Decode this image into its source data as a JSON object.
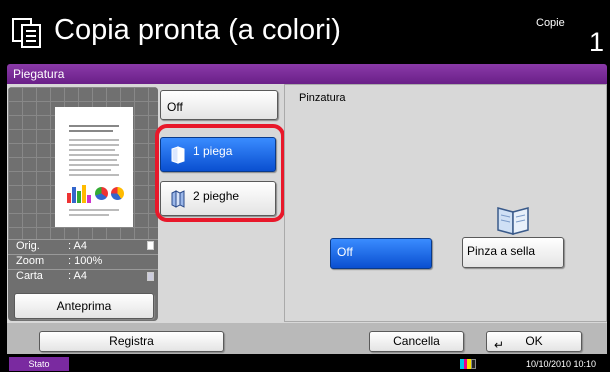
{
  "header": {
    "title": "Copia pronta (a colori)",
    "copies_label": "Copie",
    "copies_value": "1",
    "app_icon": "copy-icon"
  },
  "tab": {
    "label": "Piegatura"
  },
  "preview": {
    "info": [
      {
        "key": "Orig.",
        "value": ": A4"
      },
      {
        "key": "Zoom",
        "value": ": 100%"
      },
      {
        "key": "Carta",
        "value": ": A4"
      }
    ],
    "button_label": "Anteprima"
  },
  "fold_options": {
    "off_label": "Off",
    "one_fold_label": "1 piega",
    "two_fold_label": "2 pieghe",
    "selected": "1 piega"
  },
  "staple": {
    "section_label": "Pinzatura",
    "off_label": "Off",
    "saddle_label": "Pinza a sella",
    "selected": "Off"
  },
  "footer": {
    "registra_label": "Registra",
    "cancella_label": "Cancella",
    "ok_label": "OK"
  },
  "status": {
    "label": "Stato",
    "datetime": "10/10/2010  10:10"
  },
  "colors": {
    "accent_purple": "#7a2aa0",
    "selected_blue": "#1a63e8",
    "highlight_red": "#e8182a"
  }
}
